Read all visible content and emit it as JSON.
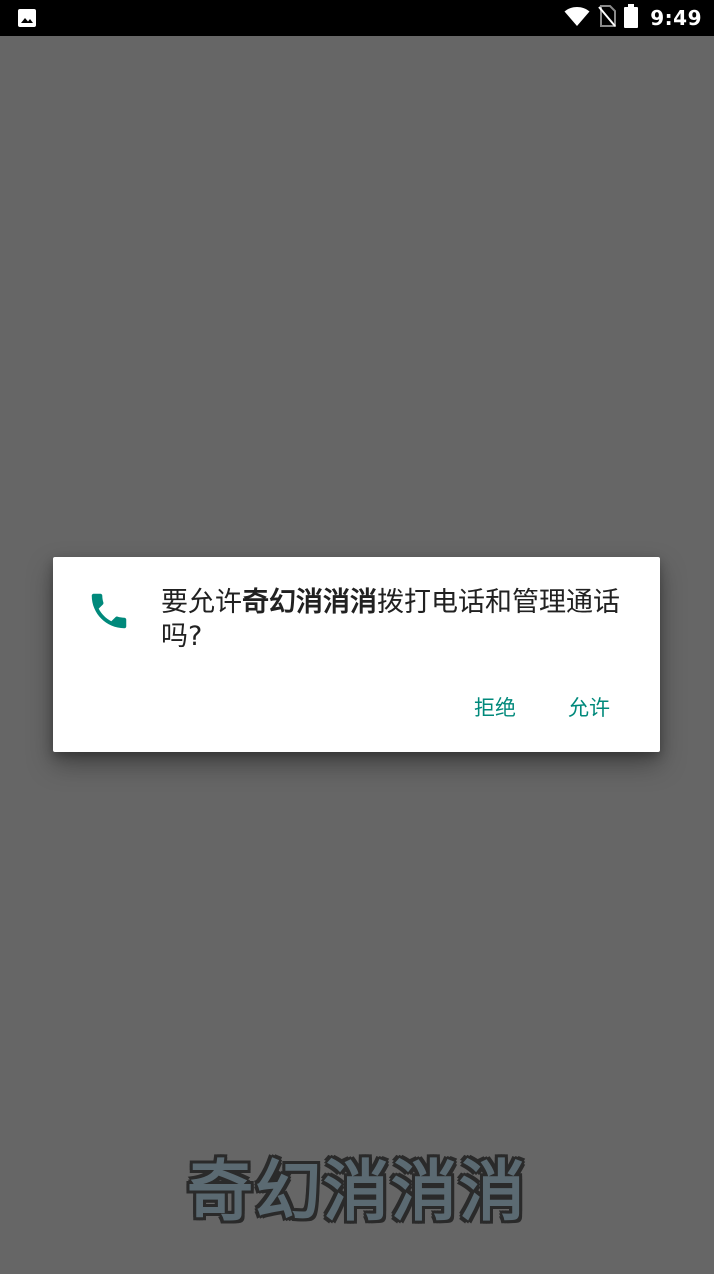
{
  "status_bar": {
    "time": "9:49",
    "icons": [
      "image-notification-icon",
      "wifi-icon",
      "no-sim-icon",
      "battery-icon"
    ]
  },
  "dialog": {
    "message_prefix": "要允许",
    "app_name": "奇幻消消消",
    "message_suffix": "拨打电话和管理通话吗?",
    "icon": "phone-icon",
    "deny_label": "拒绝",
    "allow_label": "允许"
  },
  "background": {
    "game_title": "奇幻消消消"
  },
  "colors": {
    "accent": "#00897b",
    "scrim": "#666666",
    "status_bar": "#000000"
  }
}
